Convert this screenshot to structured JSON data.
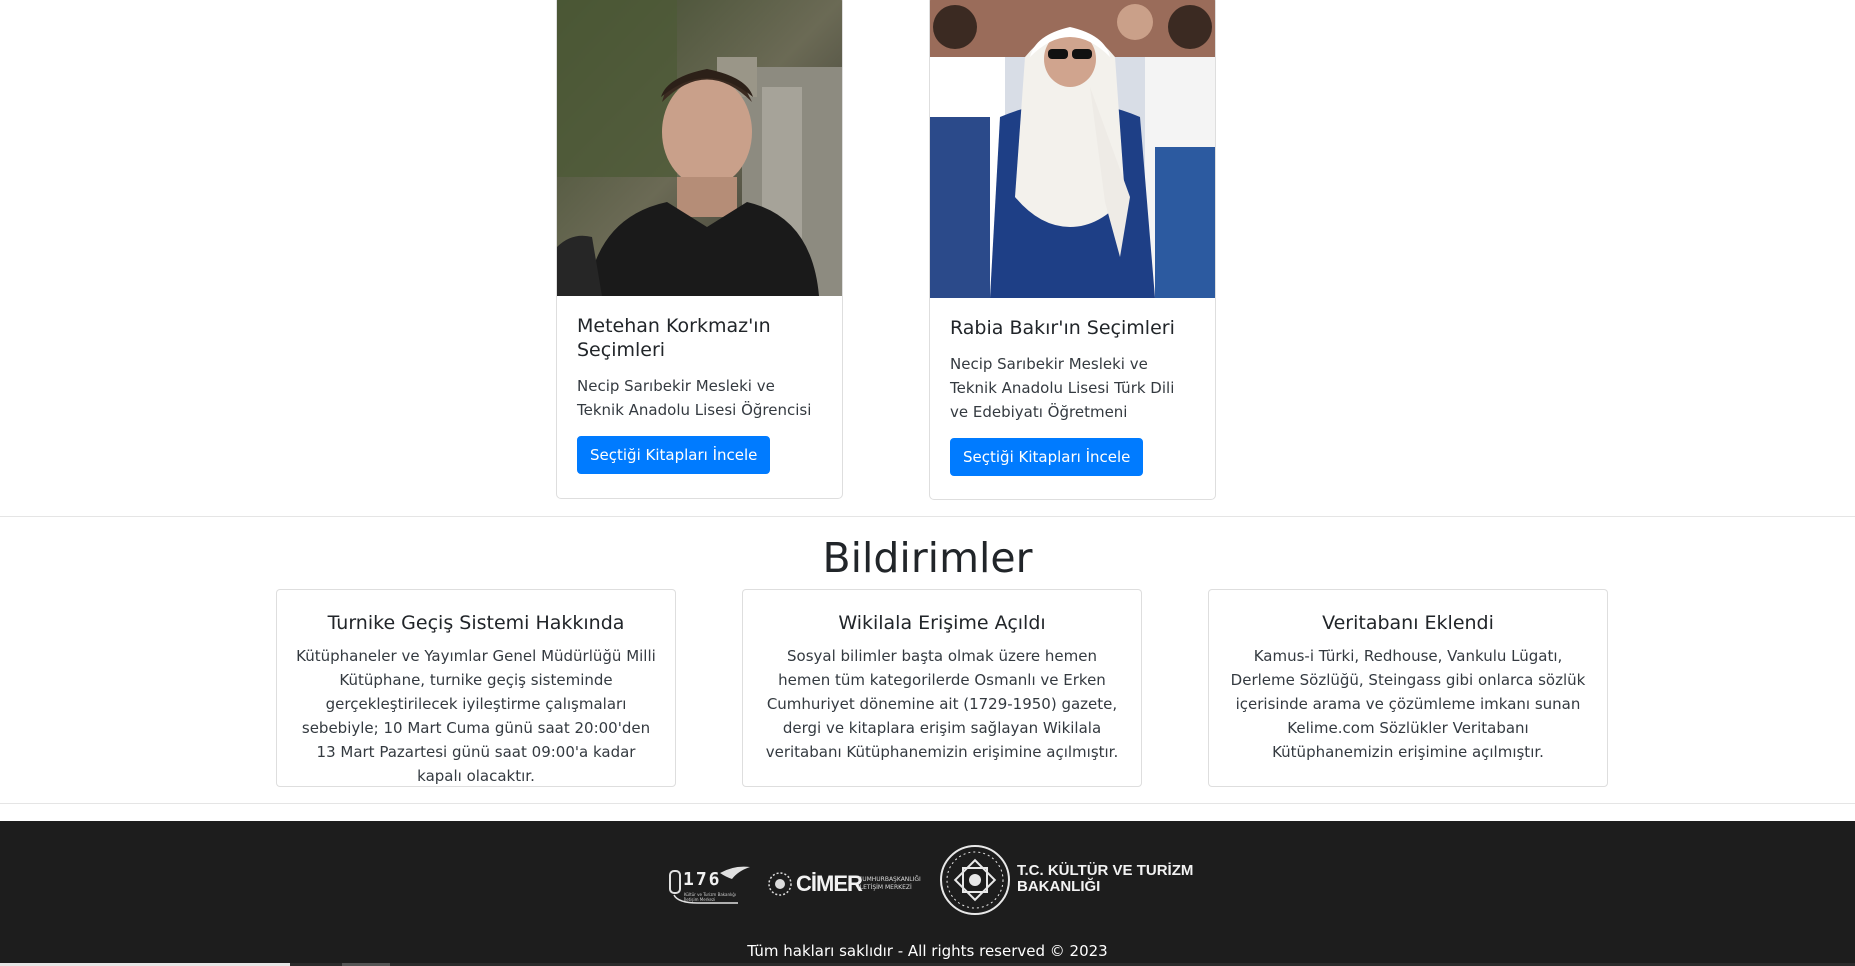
{
  "people": [
    {
      "name": "Metehan Korkmaz'ın Seçimleri",
      "description": "Necip Sarıbekir Mesleki ve Teknik Anadolu Lisesi Öğrencisi",
      "button_label": "Seçtiği Kitapları İncele"
    },
    {
      "name": "Rabia Bakır'ın Seçimleri",
      "description": "Necip Sarıbekir Mesleki ve Teknik Anadolu Lisesi Türk Dili ve Edebiyatı Öğretmeni",
      "button_label": "Seçtiği Kitapları İncele"
    }
  ],
  "notifications": {
    "heading": "Bildirimler",
    "items": [
      {
        "title": "Turnike Geçiş Sistemi Hakkında",
        "text": "Kütüphaneler ve Yayımlar Genel Müdürlüğü Milli Kütüphane, turnike geçiş sisteminde gerçekleştirilecek iyileştirme çalışmaları sebebiyle; 10 Mart Cuma günü saat 20:00'den 13 Mart Pazartesi günü saat 09:00'a kadar kapalı olacaktır."
      },
      {
        "title": "Wikilala Erişime Açıldı",
        "text": "Sosyal bilimler başta olmak üzere hemen hemen tüm kategorilerde Osmanlı ve Erken Cumhuriyet dönemine ait (1729-1950) gazete, dergi ve kitaplara erişim sağlayan Wikilala veritabanı Kütüphanemizin erişimine açılmıştır."
      },
      {
        "title": "Veritabanı Eklendi",
        "text": "Kamus-i Türki, Redhouse, Vankulu Lügatı, Derleme Sözlüğü, Steingass gibi onlarca sözlük içerisinde arama ve çözümleme imkanı sunan Kelime.com Sözlükler Veritabanı Kütüphanemizin erişimine açılmıştır."
      }
    ]
  },
  "footer": {
    "logos": {
      "line_176": {
        "number": "176",
        "subtitle": "Kültür ve Turizm Bakanlığı İletişim Merkezi"
      },
      "cimer": {
        "name": "CİMER",
        "subtitle_line1": "CUMHURBAŞKANLIĞI",
        "subtitle_line2": "İLETİŞİM MERKEZİ"
      },
      "ministry": {
        "line1": "T.C. KÜLTÜR VE TURİZM",
        "line2": "BAKANLIĞI"
      }
    },
    "copyright": "Tüm hakları saklıdır - All rights reserved © 2023"
  },
  "colors": {
    "primary": "#007bff",
    "footer_bg": "#1d1d1d"
  }
}
